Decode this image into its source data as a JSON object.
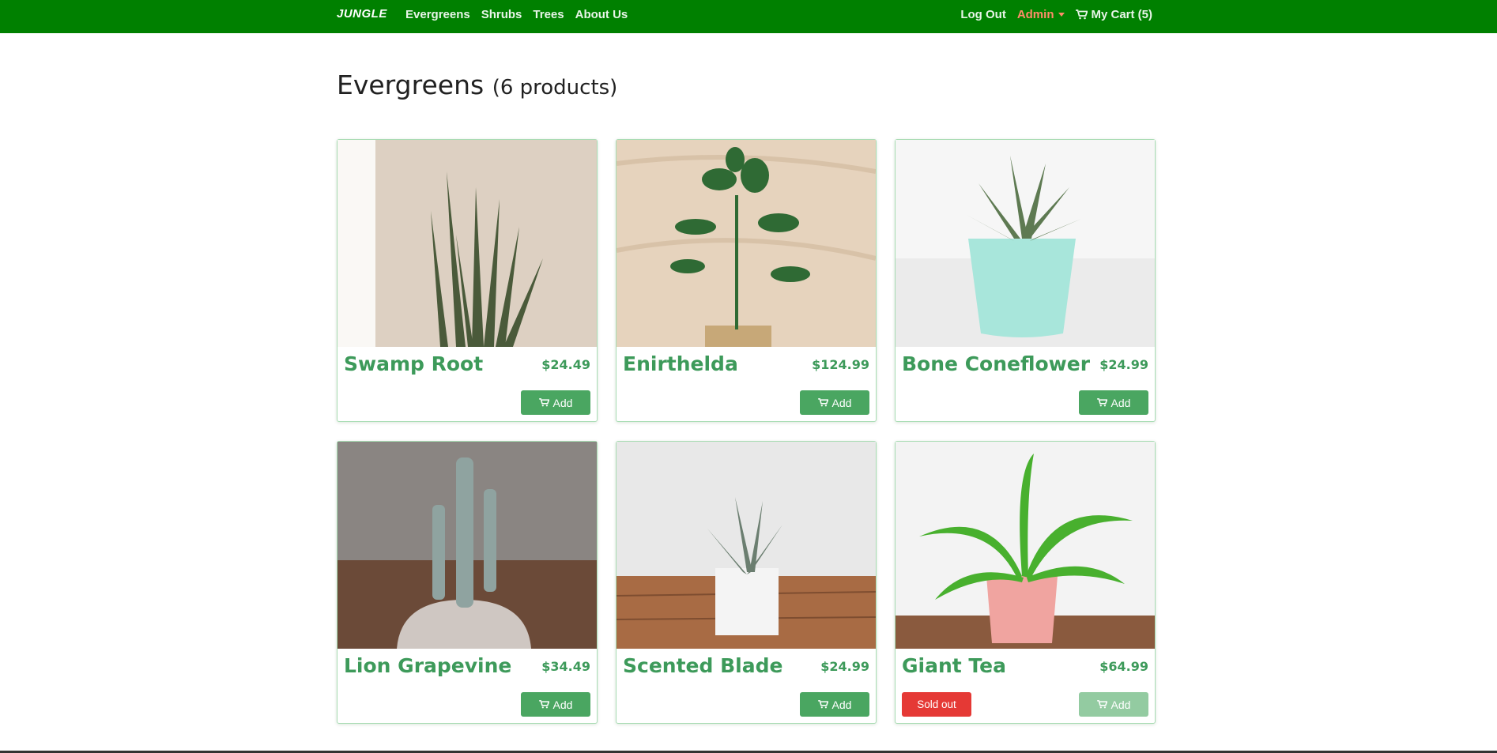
{
  "nav": {
    "brand": "JUNGLE",
    "links": [
      "Evergreens",
      "Shrubs",
      "Trees",
      "About Us"
    ],
    "logout": "Log Out",
    "admin": "Admin",
    "cart": "My Cart (5)"
  },
  "page": {
    "title": "Evergreens",
    "count": "(6 products)"
  },
  "products": [
    {
      "name": "Swamp Root",
      "price": "$24.49",
      "add": "Add",
      "sold_out": ""
    },
    {
      "name": "Enirthelda",
      "price": "$124.99",
      "add": "Add",
      "sold_out": ""
    },
    {
      "name": "Bone Coneflower",
      "price": "$24.99",
      "add": "Add",
      "sold_out": ""
    },
    {
      "name": "Lion Grapevine",
      "price": "$34.49",
      "add": "Add",
      "sold_out": ""
    },
    {
      "name": "Scented Blade",
      "price": "$24.99",
      "add": "Add",
      "sold_out": ""
    },
    {
      "name": "Giant Tea",
      "price": "$64.99",
      "add": "Add",
      "sold_out": "Sold out"
    }
  ],
  "colors": {
    "navbar": "#008000",
    "accent": "#3d9a5a",
    "button": "#4aa661",
    "sold_out": "#e53935",
    "admin": "#ff8c69"
  }
}
